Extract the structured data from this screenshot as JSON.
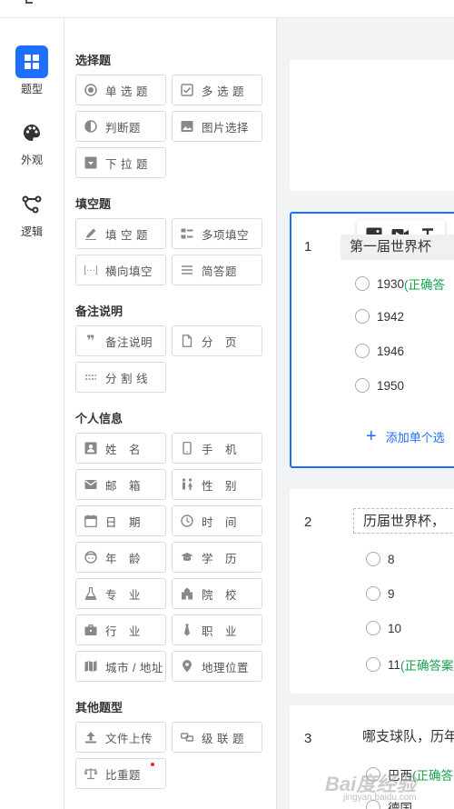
{
  "nav": [
    {
      "label": "题型",
      "icon": "grid-icon",
      "active": true
    },
    {
      "label": "外观",
      "icon": "palette-icon",
      "active": false
    },
    {
      "label": "逻辑",
      "icon": "logic-icon",
      "active": false
    }
  ],
  "palette": {
    "choice": {
      "title": "选择题",
      "items": [
        {
          "label": "单 选 题",
          "icon": "radio-icon"
        },
        {
          "label": "多 选 题",
          "icon": "checkbox-icon"
        },
        {
          "label": "判断题",
          "icon": "half-circle-icon"
        },
        {
          "label": "图片选择",
          "icon": "image-icon"
        },
        {
          "label": "下 拉 题",
          "icon": "dropdown-icon"
        }
      ]
    },
    "fill": {
      "title": "填空题",
      "items": [
        {
          "label": "填 空 题",
          "icon": "pencil-icon"
        },
        {
          "label": "多项填空",
          "icon": "multi-fill-icon"
        },
        {
          "label": "横向填空",
          "icon": "inline-fill-icon"
        },
        {
          "label": "简答题",
          "icon": "lines-icon"
        }
      ]
    },
    "remark": {
      "title": "备注说明",
      "items": [
        {
          "label": "备注说明",
          "icon": "quote-icon"
        },
        {
          "label": "分　页",
          "icon": "page-icon"
        },
        {
          "label": "分 割 线",
          "icon": "divider-icon"
        }
      ]
    },
    "personal": {
      "title": "个人信息",
      "items": [
        {
          "label": "姓　名",
          "icon": "id-card-icon"
        },
        {
          "label": "手　机",
          "icon": "phone-icon"
        },
        {
          "label": "邮　箱",
          "icon": "mail-icon"
        },
        {
          "label": "性　别",
          "icon": "gender-icon"
        },
        {
          "label": "日　期",
          "icon": "calendar-icon"
        },
        {
          "label": "时　间",
          "icon": "clock-icon"
        },
        {
          "label": "年　龄",
          "icon": "face-icon"
        },
        {
          "label": "学　历",
          "icon": "graduation-icon"
        },
        {
          "label": "专　业",
          "icon": "flask-icon"
        },
        {
          "label": "院　校",
          "icon": "school-icon"
        },
        {
          "label": "行　业",
          "icon": "briefcase-icon"
        },
        {
          "label": "职　业",
          "icon": "tie-icon"
        },
        {
          "label": "城市 / 地址",
          "icon": "map-icon"
        },
        {
          "label": "地理位置",
          "icon": "location-icon"
        }
      ]
    },
    "other": {
      "title": "其他题型",
      "items": [
        {
          "label": "文件上传",
          "icon": "upload-icon"
        },
        {
          "label": "级 联 题",
          "icon": "link-icon"
        },
        {
          "label": "比重题",
          "icon": "scale-icon",
          "badge": true
        }
      ]
    }
  },
  "questions": [
    {
      "number": "1",
      "title": "第一届世界杯",
      "options": [
        {
          "text": "1930",
          "correct_tag": "(正确答"
        },
        {
          "text": "1942",
          "correct_tag": ""
        },
        {
          "text": "1946",
          "correct_tag": ""
        },
        {
          "text": "1950",
          "correct_tag": ""
        }
      ],
      "add_option": "添加单个选"
    },
    {
      "number": "2",
      "title": "历届世界杯，",
      "options": [
        {
          "text": "8",
          "correct_tag": ""
        },
        {
          "text": "9",
          "correct_tag": ""
        },
        {
          "text": "10",
          "correct_tag": ""
        },
        {
          "text": "11",
          "correct_tag": "(正确答案"
        }
      ]
    },
    {
      "number": "3",
      "title": "哪支球队，历年",
      "options": [
        {
          "text": "巴西",
          "correct_tag": "(正确答"
        },
        {
          "text": "德国",
          "correct_tag": ""
        }
      ]
    }
  ],
  "toolbar": [
    "image-icon",
    "video-icon",
    "text-icon"
  ],
  "watermark": {
    "main": "Bai度经验",
    "sub": "jingyan.baidu.com"
  },
  "colors": {
    "accent": "#1e6fff",
    "correct": "#16a34a"
  }
}
